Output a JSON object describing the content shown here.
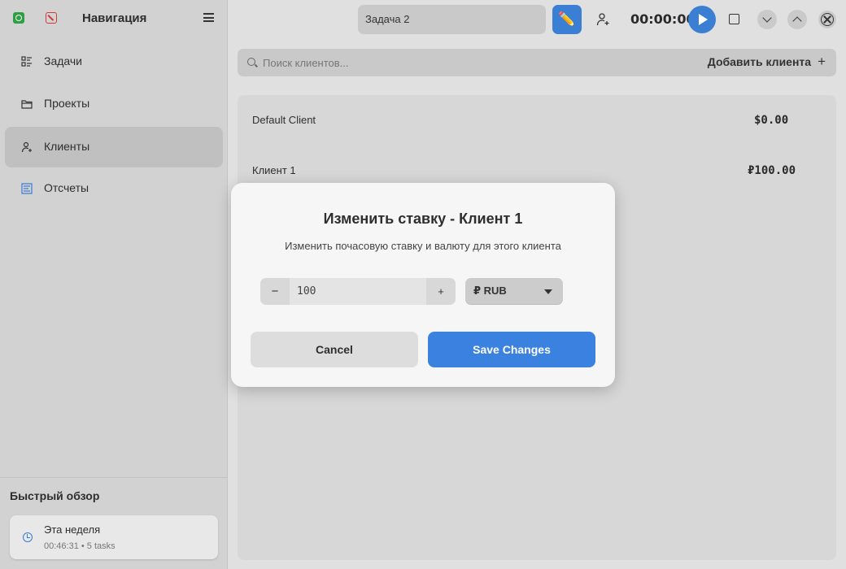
{
  "sidebar": {
    "title": "Навигация",
    "items": [
      {
        "label": "Задачи",
        "icon": "tasks-icon"
      },
      {
        "label": "Проекты",
        "icon": "folder-icon"
      },
      {
        "label": "Клиенты",
        "icon": "add-person-icon",
        "active": true
      },
      {
        "label": "Отсчеты",
        "icon": "reports-icon"
      }
    ],
    "quick_overview": {
      "title": "Быстрый обзор",
      "card_label": "Эта неделя",
      "card_sub": "00:46:31 • 5 tasks"
    }
  },
  "topbar": {
    "task_name": "Задача 2",
    "edit_icon": "✏️",
    "timer": "00:00:00"
  },
  "search": {
    "placeholder": "Поиск клиентов...",
    "add_label": "Добавить клиента",
    "add_icon": "+"
  },
  "clients": [
    {
      "name": "Default Client",
      "amount": "$0.00"
    },
    {
      "name": "Клиент 1",
      "amount": "₽100.00"
    }
  ],
  "modal": {
    "title": "Изменить ставку - Клиент 1",
    "subtitle": "Изменить почасовую ставку и валюту для этого клиента",
    "rate_value": "100",
    "minus": "−",
    "plus": "+",
    "currency": "₽ RUB",
    "cancel_label": "Cancel",
    "save_label": "Save Changes"
  },
  "colors": {
    "accent": "#3b82e0",
    "sidebar_bg": "#d2d2d2",
    "panel_bg": "#e0e0e0"
  }
}
